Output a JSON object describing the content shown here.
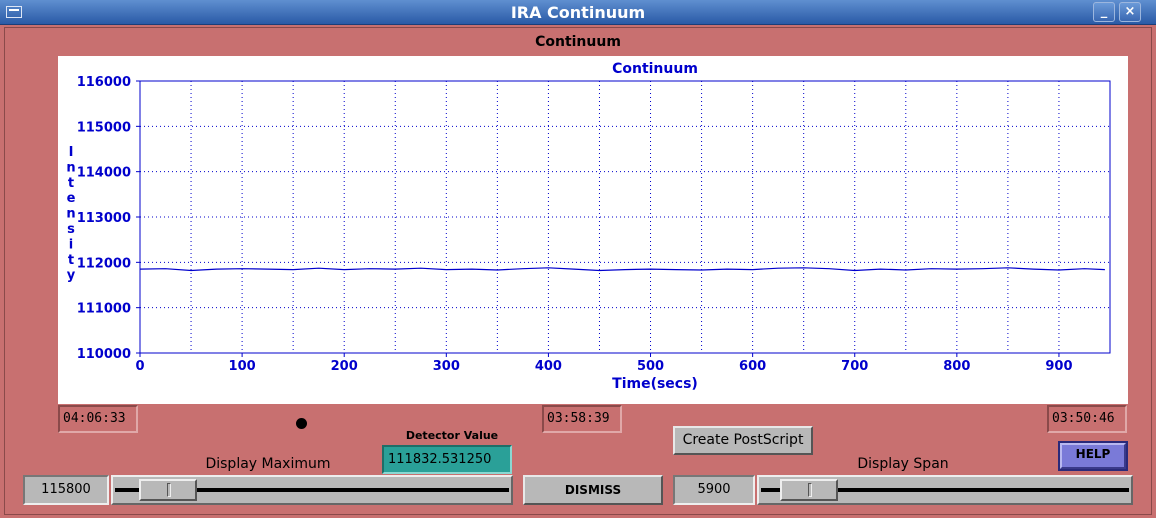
{
  "window": {
    "title": "IRA Continuum",
    "minimize_glyph": "_",
    "close_glyph": "×",
    "menu_icon": "window-menu-icon"
  },
  "panel": {
    "title": "Continuum"
  },
  "chart_data": {
    "type": "line",
    "title": "Continuum",
    "xlabel": "Time(secs)",
    "ylabel": "Intensity",
    "xlim": [
      0,
      950
    ],
    "ylim": [
      110000,
      116000
    ],
    "xticks": [
      0,
      100,
      200,
      300,
      400,
      500,
      600,
      700,
      800,
      900
    ],
    "yticks": [
      110000,
      111000,
      112000,
      113000,
      114000,
      115000,
      116000
    ],
    "grid": true,
    "color": "#0000cc",
    "series": [
      {
        "x": [
          0,
          25,
          50,
          75,
          100,
          125,
          150,
          175,
          200,
          225,
          250,
          275,
          300,
          325,
          350,
          375,
          400,
          425,
          450,
          475,
          500,
          525,
          550,
          575,
          600,
          625,
          650,
          675,
          700,
          725,
          750,
          775,
          800,
          825,
          850,
          875,
          900,
          925,
          945
        ],
        "y": [
          111850,
          111860,
          111820,
          111850,
          111860,
          111850,
          111840,
          111870,
          111840,
          111860,
          111850,
          111870,
          111840,
          111850,
          111830,
          111860,
          111880,
          111850,
          111820,
          111840,
          111850,
          111840,
          111830,
          111850,
          111840,
          111870,
          111880,
          111860,
          111820,
          111850,
          111830,
          111860,
          111850,
          111860,
          111880,
          111850,
          111830,
          111860,
          111840
        ]
      }
    ]
  },
  "times": {
    "left": "04:06:33",
    "center": "03:58:39",
    "right": "03:50:46"
  },
  "detector": {
    "label": "Detector Value",
    "value": "111832.531250"
  },
  "buttons": {
    "postscript": "Create PostScript",
    "help": "HELP",
    "dismiss": "DISMISS"
  },
  "display_max": {
    "label": "Display Maximum",
    "value": "115800",
    "level": 0.07
  },
  "display_span": {
    "label": "Display Span",
    "value": "5900",
    "level": 0.06
  }
}
